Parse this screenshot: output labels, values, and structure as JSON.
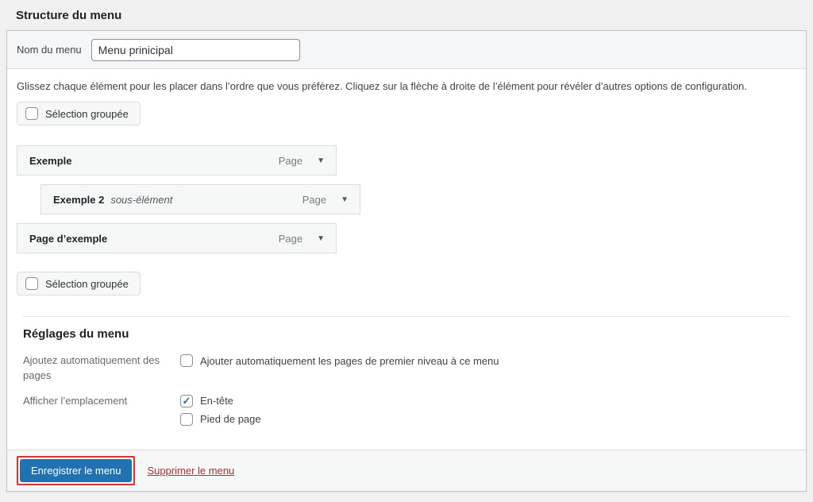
{
  "page": {
    "title": "Structure du menu"
  },
  "menu_name": {
    "label": "Nom du menu",
    "value": "Menu prinicipal"
  },
  "instructions": "Glissez chaque élément pour les placer dans l’ordre que vous préférez. Cliquez sur la flèche à droite de l’élément pour révéler d’autres options de configuration.",
  "bulk_select": {
    "label": "Sélection groupée",
    "checked": false
  },
  "menu_items": [
    {
      "title": "Exemple",
      "sub_label": "",
      "type": "Page",
      "depth": 0
    },
    {
      "title": "Exemple 2",
      "sub_label": "sous-élément",
      "type": "Page",
      "depth": 1
    },
    {
      "title": "Page d’exemple",
      "sub_label": "",
      "type": "Page",
      "depth": 0
    }
  ],
  "settings": {
    "heading": "Réglages du menu",
    "auto_add": {
      "label": "Ajoutez automatiquement des pages",
      "option": "Ajouter automatiquement les pages de premier niveau à ce menu",
      "checked": false
    },
    "display_location": {
      "label": "Afficher l’emplacement",
      "options": [
        {
          "label": "En-tête",
          "checked": true
        },
        {
          "label": "Pied de page",
          "checked": false
        }
      ]
    }
  },
  "footer": {
    "save_label": "Enregistrer le menu",
    "delete_label": "Supprimer le menu"
  },
  "icons": {
    "dropdown_arrow": "▼"
  },
  "colors": {
    "accent_blue": "#2271b1",
    "delete_red": "#b32d2e",
    "annotation_red": "#d63333",
    "page_bg": "#f0f0f1",
    "panel_bg": "#ffffff",
    "row_bg": "#f6f7f7"
  }
}
